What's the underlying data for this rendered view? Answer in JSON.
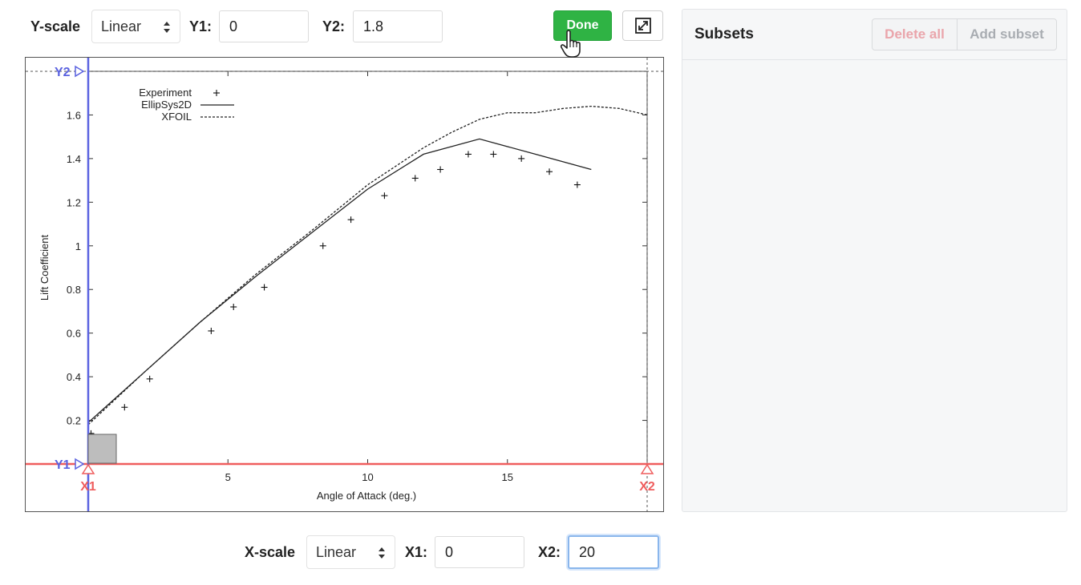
{
  "yscale": {
    "label": "Y-scale",
    "value": "Linear"
  },
  "y1": {
    "label": "Y1:",
    "value": "0"
  },
  "y2": {
    "label": "Y2:",
    "value": "1.8"
  },
  "done_label": "Done",
  "xscale": {
    "label": "X-scale",
    "value": "Linear"
  },
  "x1": {
    "label": "X1:",
    "value": "0"
  },
  "x2": {
    "label": "X2:",
    "value": "20"
  },
  "subsets": {
    "title": "Subsets",
    "delete_all": "Delete all",
    "add_subset": "Add subset"
  },
  "markers": {
    "y1": "Y1",
    "y2": "Y2",
    "x1": "X1",
    "x2": "X2"
  },
  "colors": {
    "done": "#2fb344",
    "y_markers": "#5a62e0",
    "x_markers": "#ef5d5d"
  },
  "chart_data": {
    "type": "line",
    "xlabel": "Angle of Attack (deg.)",
    "ylabel": "Lift Coefficient",
    "xlim": [
      0,
      20
    ],
    "ylim": [
      0,
      1.8
    ],
    "xticks": [
      5,
      10,
      15
    ],
    "yticks": [
      0.2,
      0.4,
      0.6,
      0.8,
      1,
      1.2,
      1.4,
      1.6
    ],
    "legend": "top-left",
    "series": [
      {
        "name": "Experiment",
        "style": "points",
        "x": [
          0.1,
          1.3,
          2.2,
          4.4,
          5.2,
          6.3,
          8.4,
          9.4,
          10.6,
          11.7,
          12.6,
          13.6,
          14.5,
          15.5,
          16.5,
          17.5
        ],
        "y": [
          0.14,
          0.26,
          0.39,
          0.61,
          0.72,
          0.81,
          1.0,
          1.12,
          1.23,
          1.31,
          1.35,
          1.42,
          1.42,
          1.4,
          1.34,
          1.28
        ]
      },
      {
        "name": "EllipSys2D",
        "style": "solid",
        "x": [
          0,
          2,
          4,
          6,
          8,
          10,
          12,
          14,
          16,
          18
        ],
        "y": [
          0.19,
          0.42,
          0.65,
          0.86,
          1.06,
          1.26,
          1.42,
          1.49,
          1.42,
          1.35
        ]
      },
      {
        "name": "XFOIL",
        "style": "dashed",
        "x": [
          0,
          2,
          4,
          6,
          8,
          10,
          12,
          13,
          14,
          15,
          16,
          17,
          18,
          19,
          20
        ],
        "y": [
          0.18,
          0.42,
          0.65,
          0.87,
          1.07,
          1.28,
          1.45,
          1.52,
          1.58,
          1.61,
          1.61,
          1.63,
          1.64,
          1.63,
          1.6
        ]
      }
    ]
  }
}
